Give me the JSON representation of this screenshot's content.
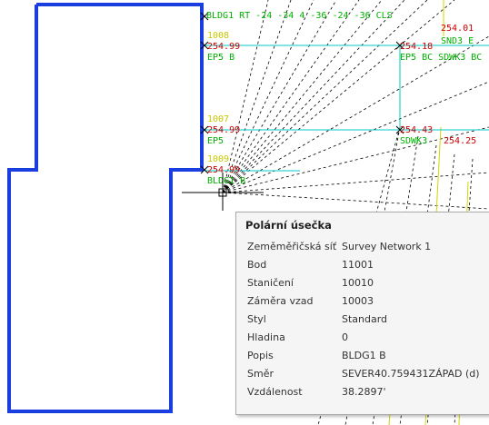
{
  "drawing": {
    "building_label": "BLDG1 RT -24 -34 4 -36 -24 -36 CLS",
    "building_label2": "BLDG1 B",
    "points": [
      {
        "num": "1007",
        "elev": "254.99",
        "code": "EP5"
      },
      {
        "num": "1008",
        "elev": "254.99",
        "code": "EP5 B"
      },
      {
        "num": "1009",
        "elev": "254.99",
        "code": "BLDG1 B"
      },
      {
        "num": "",
        "elev": "254.99",
        "code": "EP5"
      }
    ],
    "right_labels": [
      {
        "elev": "254.18",
        "code": "EP5 BC SDWK3 BC"
      },
      {
        "elev": "254.01",
        "code": "SND3 E"
      },
      {
        "elev": "254.25",
        "code": ""
      },
      {
        "elev": "254.43",
        "code": "SDWK3"
      }
    ],
    "colors": {
      "building": "#1a3ee0",
      "elev": "#d00000",
      "code": "#00b000",
      "num": "#c8c800",
      "grid": "#00c8c8"
    }
  },
  "tooltip": {
    "title": "Polární úsečka",
    "rows": [
      {
        "key": "Zeměměřičská síť",
        "value": "Survey Network 1"
      },
      {
        "key": "Bod",
        "value": "11001"
      },
      {
        "key": "Staničení",
        "value": "10010"
      },
      {
        "key": "Záměra vzad",
        "value": "10003"
      },
      {
        "key": "Styl",
        "value": "Standard"
      },
      {
        "key": "Hladina",
        "value": "0"
      },
      {
        "key": "Popis",
        "value": "BLDG1 B"
      },
      {
        "key": "Směr",
        "value": "SEVER40.759431ZÁPAD (d)"
      },
      {
        "key": "Vzdálenost",
        "value": "38.2897'"
      }
    ]
  }
}
